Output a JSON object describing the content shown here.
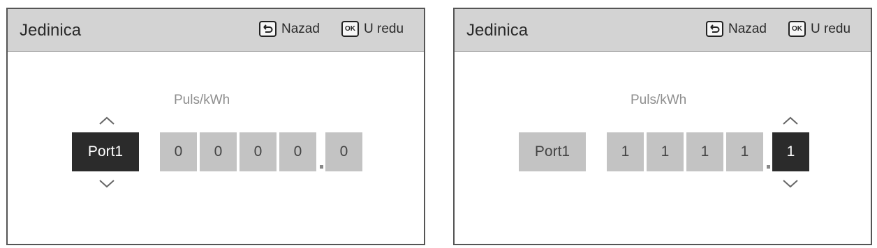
{
  "panels": [
    {
      "title": "Jedinica",
      "back_label": "Nazad",
      "ok_label": "U redu",
      "ok_icon_text": "OK",
      "unit_label": "Puls/kWh",
      "port_label": "Port1",
      "digits": [
        "0",
        "0",
        "0",
        "0",
        "0"
      ],
      "selected_field": "port"
    },
    {
      "title": "Jedinica",
      "back_label": "Nazad",
      "ok_label": "U redu",
      "ok_icon_text": "OK",
      "unit_label": "Puls/kWh",
      "port_label": "Port1",
      "digits": [
        "1",
        "1",
        "1",
        "1",
        "1"
      ],
      "selected_field": "digit-5"
    }
  ],
  "icons": {
    "back": "back-arrow-icon",
    "ok": "ok-icon",
    "up": "chevron-up-icon",
    "down": "chevron-down-icon"
  }
}
